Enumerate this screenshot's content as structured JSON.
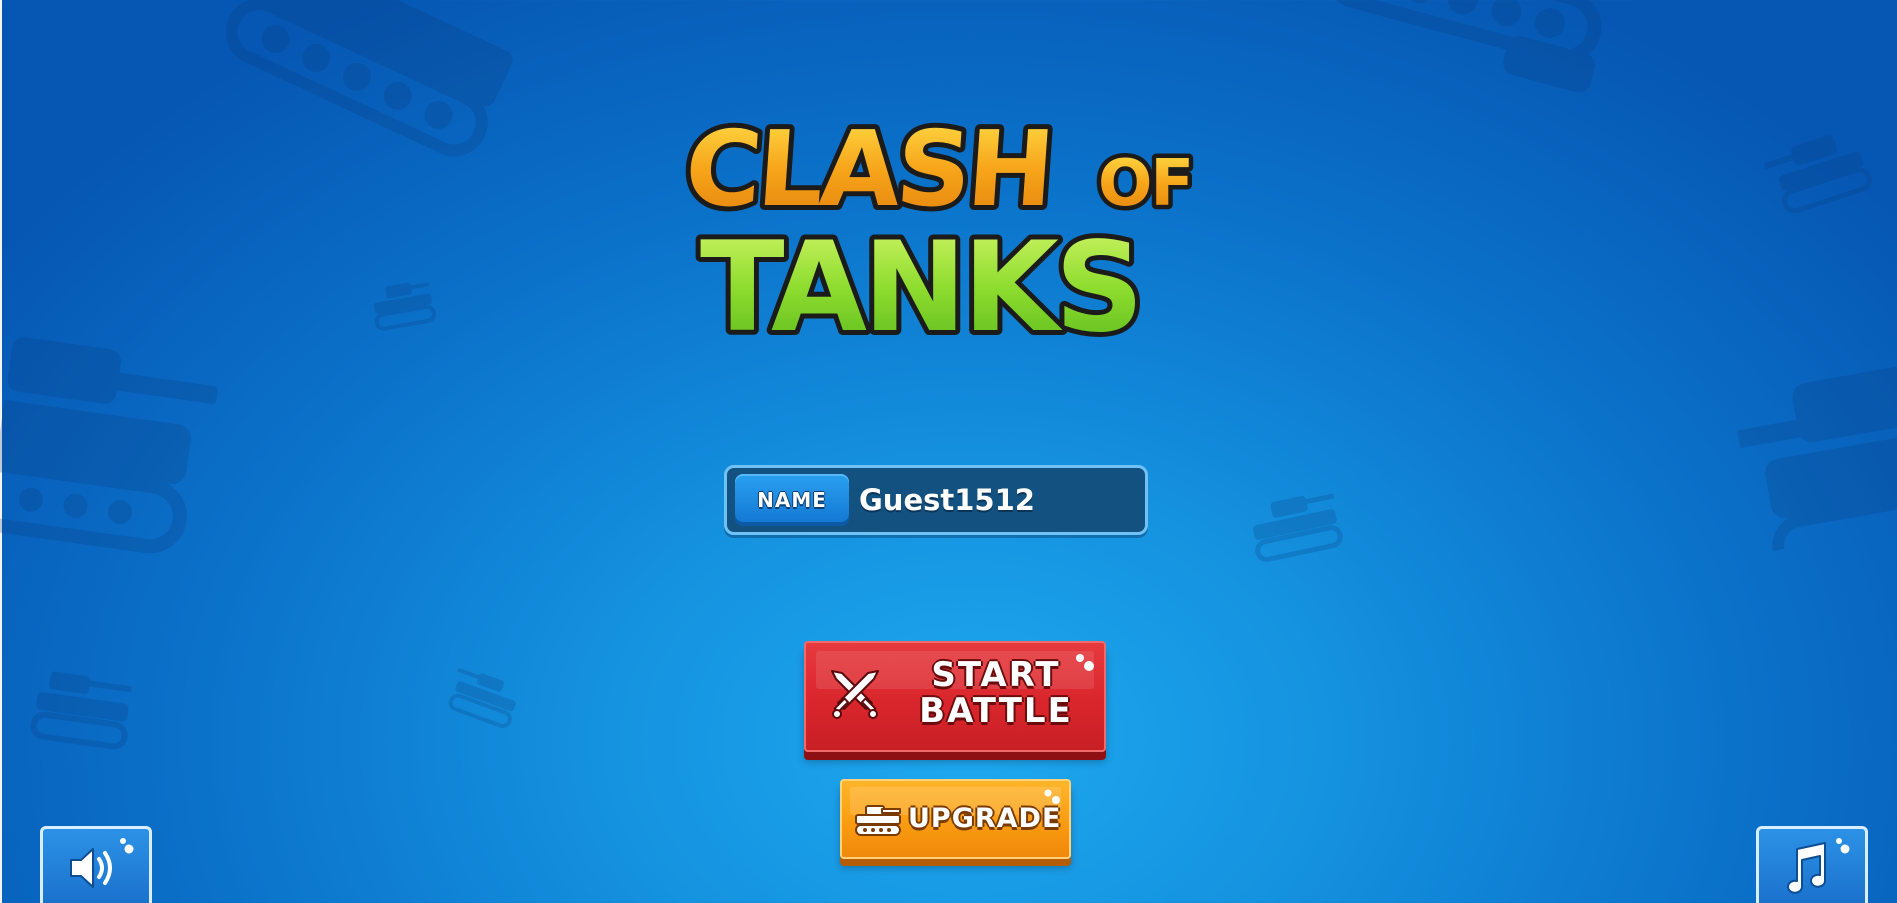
{
  "logo": {
    "line1": "CLASH",
    "line1_small": "OF",
    "line2": "TANKS"
  },
  "player": {
    "name_label": "NAME",
    "name_value": "Guest1512"
  },
  "buttons": {
    "start_line1": "START",
    "start_line2": "BATTLE",
    "upgrade": "UPGRADE"
  },
  "icons": {
    "start": "crossed-swords-icon",
    "upgrade": "tank-icon",
    "sound": "speaker-icon",
    "music": "music-note-icon"
  },
  "colors": {
    "background": "#1593e0",
    "start_button": "#d9262c",
    "upgrade_button": "#f99a10",
    "logo_orange": "#f7a51a",
    "logo_green": "#7fd62a"
  }
}
